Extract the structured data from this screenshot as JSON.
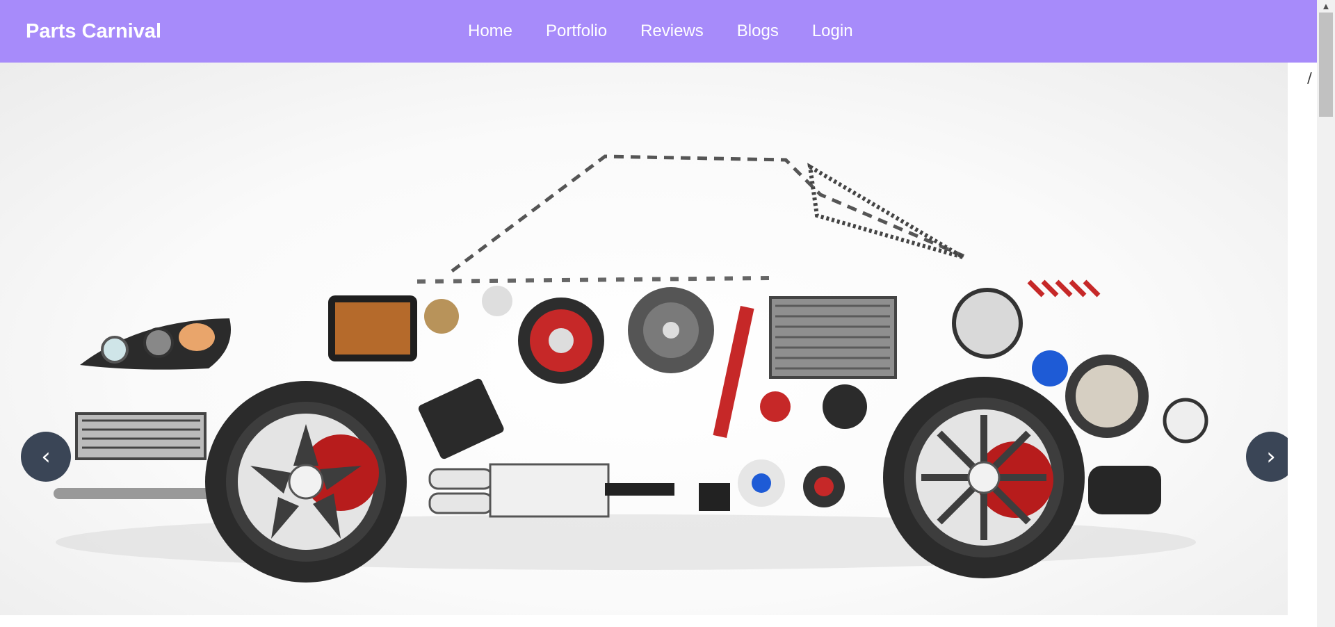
{
  "brand": {
    "name": "Parts Carnival"
  },
  "nav": {
    "items": [
      {
        "label": "Home"
      },
      {
        "label": "Portfolio"
      },
      {
        "label": "Reviews"
      },
      {
        "label": "Blogs"
      },
      {
        "label": "Login"
      }
    ]
  },
  "carousel": {
    "prev_label": "‹",
    "next_label": "›",
    "slide_alt": "Car made of auto parts"
  },
  "stray_text": "/",
  "colors": {
    "navbar": "#a78bfa",
    "carousel_button": "#3a4556",
    "accent_red": "#c8102e"
  },
  "icons": [
    "chevron-left-icon",
    "chevron-right-icon",
    "scroll-up-arrow-icon"
  ]
}
